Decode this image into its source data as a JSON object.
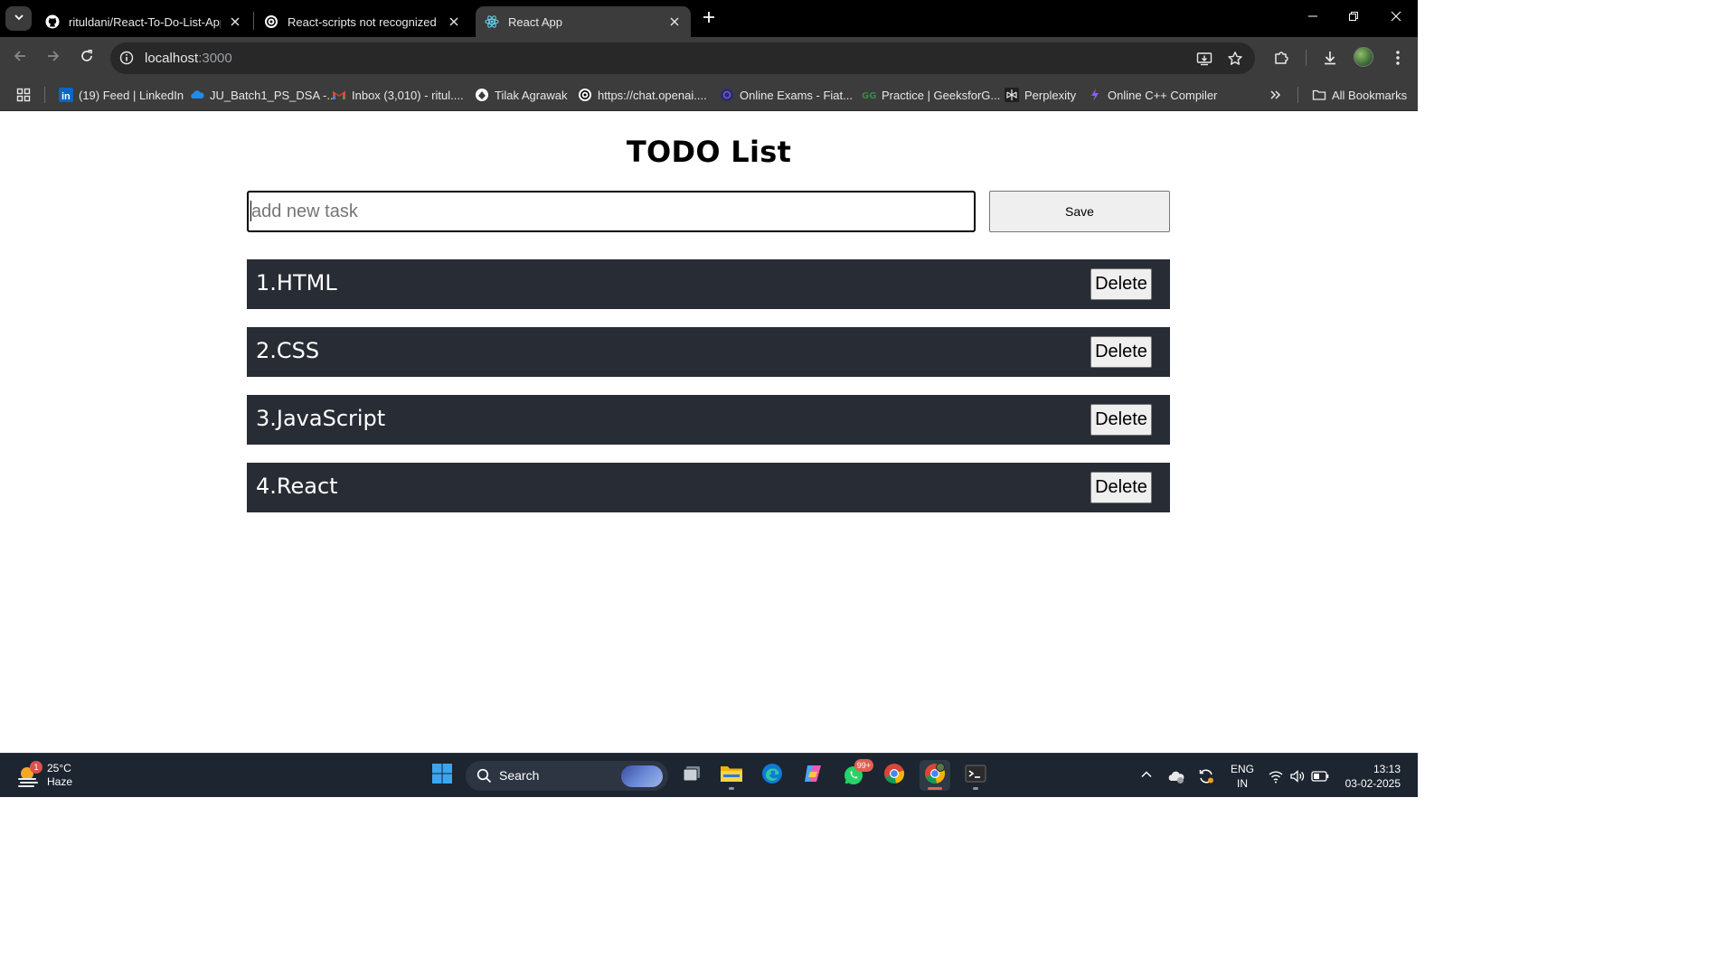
{
  "browser": {
    "tabs": [
      {
        "title": "rituldani/React-To-Do-List-App",
        "icon": "github-icon",
        "active": false
      },
      {
        "title": "React-scripts not recognized",
        "icon": "chatgpt-icon",
        "active": false
      },
      {
        "title": "React App",
        "icon": "react-icon",
        "active": true
      }
    ],
    "address": {
      "host": "localhost",
      "port": ":3000"
    },
    "bookmarks": [
      {
        "label": "(19) Feed | LinkedIn",
        "icon": "linkedin-icon"
      },
      {
        "label": "JU_Batch1_PS_DSA -...",
        "icon": "onedrive-icon"
      },
      {
        "label": "Inbox (3,010) - ritul....",
        "icon": "gmail-icon"
      },
      {
        "label": "Tilak Agrawak",
        "icon": "globe-icon"
      },
      {
        "label": "https://chat.openai....",
        "icon": "chatgpt-icon"
      },
      {
        "label": "Online Exams - Fiat...",
        "icon": "exam-icon"
      },
      {
        "label": "Practice | GeeksforG...",
        "icon": "geeksforgeeks-icon"
      },
      {
        "label": "Perplexity",
        "icon": "perplexity-icon"
      },
      {
        "label": "Online C++ Compiler",
        "icon": "compiler-icon"
      }
    ],
    "all_bookmarks_label": "All Bookmarks"
  },
  "app": {
    "title": "TODO List",
    "input_placeholder": "add new task",
    "save_label": "Save",
    "tasks": [
      {
        "text": "1.HTML",
        "delete_label": "Delete"
      },
      {
        "text": "2.CSS",
        "delete_label": "Delete"
      },
      {
        "text": "3.JavaScript",
        "delete_label": "Delete"
      },
      {
        "text": "4.React",
        "delete_label": "Delete"
      }
    ]
  },
  "taskbar": {
    "weather": {
      "temp": "25°C",
      "condition": "Haze",
      "badge": "1"
    },
    "search_label": "Search",
    "whatsapp_badge": "99+",
    "language": {
      "line1": "ENG",
      "line2": "IN"
    },
    "clock": {
      "time": "13:13",
      "date": "03-02-2025"
    }
  },
  "colors": {
    "task_row": "#282c34",
    "chrome_dark": "#000000",
    "chrome_toolbar": "#3c3c3c",
    "taskbar": "#1c2530"
  }
}
